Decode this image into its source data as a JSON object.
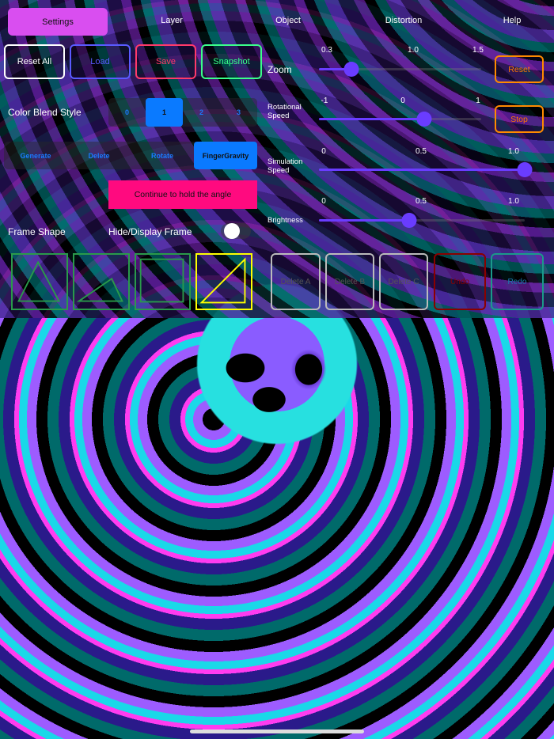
{
  "tabs": {
    "settings": "Settings",
    "layer": "Layer",
    "object": "Object",
    "distortion": "Distortion",
    "help": "Help"
  },
  "buttons": {
    "reset_all": "Reset All",
    "load": "Load",
    "save": "Save",
    "snapshot": "Snapshot",
    "hold_angle": "Continue to hold the angle",
    "reset": "Reset",
    "stop": "Stop"
  },
  "color_blend": {
    "label": "Color Blend Style",
    "options": [
      "0",
      "1",
      "2",
      "3"
    ],
    "selected": "1"
  },
  "mode": {
    "options": [
      "Generate",
      "Delete",
      "Rotate",
      "FingerGravity"
    ],
    "selected": "FingerGravity"
  },
  "frame_shape": {
    "label": "Frame Shape",
    "toggle_label": "Hide/Display Frame",
    "toggle_on": false,
    "selected_index": 3
  },
  "actions": {
    "delete_a": "Delete A",
    "delete_b": "Delete B",
    "delete_c": "Delete C",
    "undo": "Undo",
    "redo": "Redo"
  },
  "sliders": {
    "zoom": {
      "label": "Zoom",
      "ticks": [
        "0.3",
        "1.0",
        "1.5"
      ],
      "value_fraction": 0.2
    },
    "rotation": {
      "label": "Rotational Speed",
      "ticks": [
        "-1",
        "0",
        "1"
      ],
      "value_fraction": 0.65
    },
    "simulation": {
      "label": "Simulation Speed",
      "ticks": [
        "0",
        "0.5",
        "1.0"
      ],
      "value_fraction": 1.0
    },
    "brightness": {
      "label": "Brightness",
      "ticks": [
        "0",
        "0.5",
        "1.0"
      ],
      "value_fraction": 0.44
    }
  },
  "colors": {
    "accent": "#6a3cff",
    "settings": "#d94ef0",
    "hold": "#ff0a7f",
    "segment": "#0a7aff"
  }
}
